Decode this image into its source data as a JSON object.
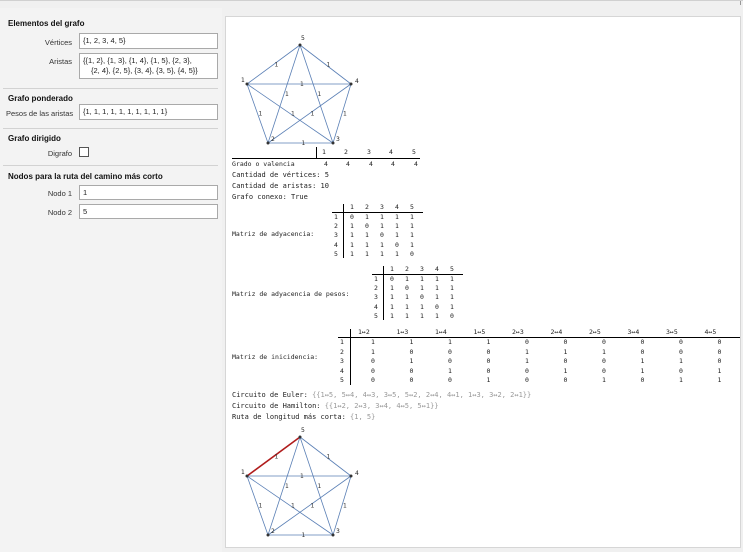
{
  "panel": {
    "graph_section": "Elementos del grafo",
    "vertices_label": "Vértices",
    "vertices_value": "{1, 2, 3, 4, 5}",
    "edges_label": "Aristas",
    "edges_line1": "{{1, 2}, {1, 3}, {1, 4}, {1, 5}, {2, 3},",
    "edges_line2": "{2, 4}, {2, 5}, {3, 4}, {3, 5}, {4, 5}}",
    "weighted_section": "Grafo ponderado",
    "weights_label": "Pesos de las aristas",
    "weights_value": "{1, 1, 1, 1, 1, 1, 1, 1, 1, 1}",
    "directed_section": "Grafo dirigido",
    "digraph_label": "Digrafo",
    "digraph_checked": false,
    "path_section": "Nodos para la ruta del camino más corto",
    "node1_label": "Nodo 1",
    "node1_value": "1",
    "node2_label": "Nodo 2",
    "node2_value": "5"
  },
  "graph": {
    "vertex_labels": [
      "1",
      "2",
      "3",
      "4",
      "5"
    ],
    "edge_weight_label": "1",
    "edge_color": "#5a7fb5",
    "path_color": "#b01c1c"
  },
  "degree_table": {
    "header": [
      "1",
      "2",
      "3",
      "4",
      "5"
    ],
    "row_label": "Grado o valencia",
    "values": [
      "4",
      "4",
      "4",
      "4",
      "4"
    ]
  },
  "stats": {
    "vertices": "Cantidad de vértices: 5",
    "edges": "Cantidad de aristas: 10",
    "connected": "Grafo conexo: True"
  },
  "adjacency": {
    "label": "Matriz de adyacencia:",
    "header": [
      "1",
      "2",
      "3",
      "4",
      "5"
    ],
    "rows": [
      {
        "label": "1",
        "values": [
          "0",
          "1",
          "1",
          "1",
          "1"
        ]
      },
      {
        "label": "2",
        "values": [
          "1",
          "0",
          "1",
          "1",
          "1"
        ]
      },
      {
        "label": "3",
        "values": [
          "1",
          "1",
          "0",
          "1",
          "1"
        ]
      },
      {
        "label": "4",
        "values": [
          "1",
          "1",
          "1",
          "0",
          "1"
        ]
      },
      {
        "label": "5",
        "values": [
          "1",
          "1",
          "1",
          "1",
          "0"
        ]
      }
    ]
  },
  "weighted_adjacency": {
    "label": "Matriz de adyacencia de pesos:",
    "header": [
      "1",
      "2",
      "3",
      "4",
      "5"
    ],
    "rows": [
      {
        "label": "1",
        "values": [
          "0",
          "1",
          "1",
          "1",
          "1"
        ]
      },
      {
        "label": "2",
        "values": [
          "1",
          "0",
          "1",
          "1",
          "1"
        ]
      },
      {
        "label": "3",
        "values": [
          "1",
          "1",
          "0",
          "1",
          "1"
        ]
      },
      {
        "label": "4",
        "values": [
          "1",
          "1",
          "1",
          "0",
          "1"
        ]
      },
      {
        "label": "5",
        "values": [
          "1",
          "1",
          "1",
          "1",
          "0"
        ]
      }
    ]
  },
  "incidence": {
    "label": "Matriz de inicidencia:",
    "header": [
      "1↔2",
      "1↔3",
      "1↔4",
      "1↔5",
      "2↔3",
      "2↔4",
      "2↔5",
      "3↔4",
      "3↔5",
      "4↔5"
    ],
    "rows": [
      {
        "label": "1",
        "values": [
          "1",
          "1",
          "1",
          "1",
          "0",
          "0",
          "0",
          "0",
          "0",
          "0"
        ]
      },
      {
        "label": "2",
        "values": [
          "1",
          "0",
          "0",
          "0",
          "1",
          "1",
          "1",
          "0",
          "0",
          "0"
        ]
      },
      {
        "label": "3",
        "values": [
          "0",
          "1",
          "0",
          "0",
          "1",
          "0",
          "0",
          "1",
          "1",
          "0"
        ]
      },
      {
        "label": "4",
        "values": [
          "0",
          "0",
          "1",
          "0",
          "0",
          "1",
          "0",
          "1",
          "0",
          "1"
        ]
      },
      {
        "label": "5",
        "values": [
          "0",
          "0",
          "0",
          "1",
          "0",
          "0",
          "1",
          "0",
          "1",
          "1"
        ]
      }
    ]
  },
  "circuits": {
    "euler_label": "Circuito de Euler: ",
    "euler_value": "{{1↔5, 5↔4, 4↔3, 3↔5, 5↔2, 2↔4, 4↔1, 1↔3, 3↔2, 2↔1}}",
    "hamilton_label": "Circuito de Hamilton: ",
    "hamilton_value": "{{1↔2, 2↔3, 3↔4, 4↔5, 5↔1}}",
    "path_label": "Ruta de longitud más corta: ",
    "path_value": "{1, 5}"
  }
}
